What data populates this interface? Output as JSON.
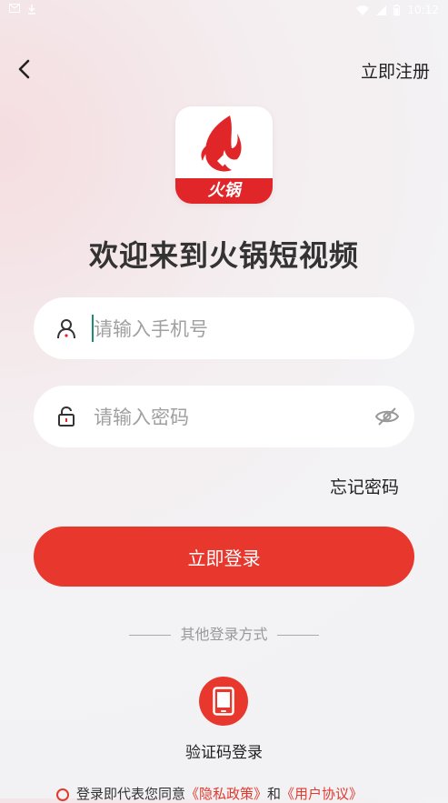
{
  "status_bar": {
    "time": "10:12",
    "left_icons": [
      "mail-icon",
      "download-icon"
    ]
  },
  "header": {
    "register_label": "立即注册"
  },
  "logo": {
    "text": "火锅"
  },
  "title": "欢迎来到火锅短视频",
  "phone_field": {
    "placeholder": "请输入手机号",
    "value": ""
  },
  "password_field": {
    "placeholder": "请输入密码",
    "value": ""
  },
  "forgot_label": "忘记密码",
  "login_button": "立即登录",
  "other_methods_label": "其他登录方式",
  "sms_login_label": "验证码登录",
  "agreement": {
    "prefix": "登录即代表您同意",
    "privacy": "《隐私政策》",
    "and": "和",
    "terms": "《用户协议》"
  },
  "colors": {
    "primary": "#e8372c",
    "link": "#e03a2e",
    "caret": "#1b8c74"
  }
}
